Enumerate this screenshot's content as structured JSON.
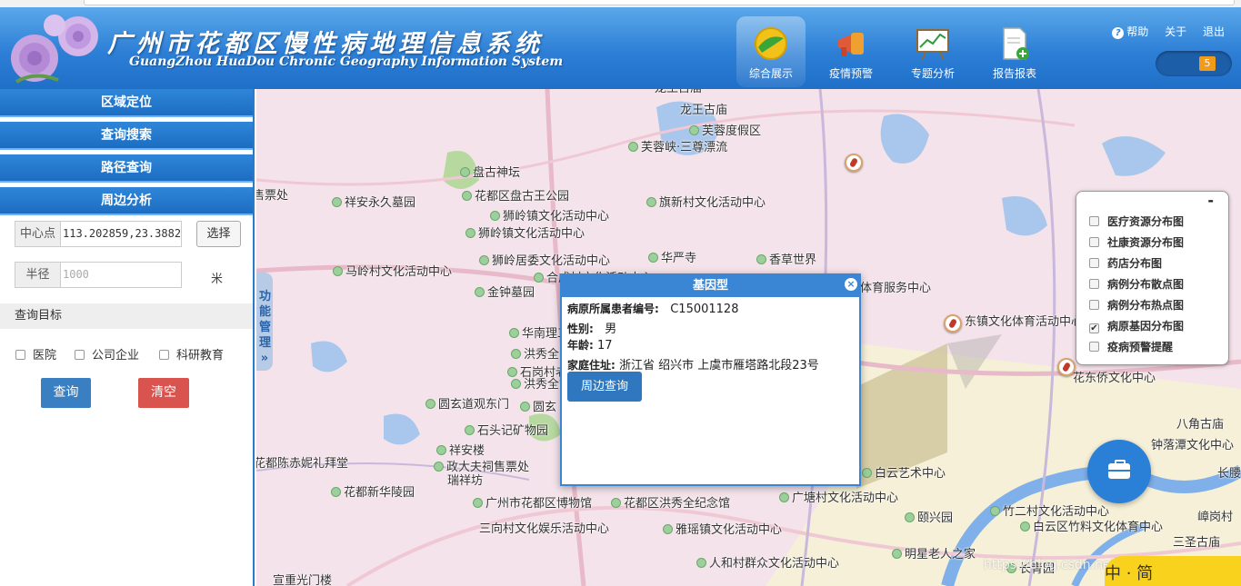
{
  "app": {
    "title_cn": "广州市花都区慢性病地理信息系统",
    "title_en": "GuangZhou HuaDou Chronic Geography Information System"
  },
  "nav": [
    {
      "label": "综合展示",
      "icon": "globe-icon"
    },
    {
      "label": "疫情预警",
      "icon": "megaphone-icon"
    },
    {
      "label": "专题分析",
      "icon": "chart-board-icon"
    },
    {
      "label": "报告报表",
      "icon": "report-add-icon"
    }
  ],
  "toplinks": {
    "help": "帮助",
    "about": "关于",
    "logout": "退出"
  },
  "notify_count": "5",
  "sidebar": {
    "sections": [
      "区域定位",
      "查询搜索",
      "路径查询",
      "周边分析"
    ],
    "center_label": "中心点",
    "center_value": "113.202859,23.38825",
    "choose": "选择",
    "radius_label": "半径",
    "radius_placeholder": "1000",
    "unit": "米",
    "target_title": "查询目标",
    "targets": [
      "医院",
      "公司企业",
      "科研教育"
    ],
    "query": "查询",
    "clear": "清空"
  },
  "side_tab": "功能管理",
  "popup": {
    "title": "基因型",
    "id_label": "病原所属患者编号:",
    "id_value": "C15001128",
    "sex_label": "性别:",
    "sex_value": "男",
    "age_label": "年龄:",
    "age_value": "17",
    "addr_label": "家庭住址:",
    "addr_value": "浙江省 绍兴市 上虞市雁塔路北段23号",
    "nearby": "周边查询"
  },
  "layers": {
    "minimize": "-",
    "items": [
      {
        "label": "医疗资源分布图",
        "checked": false
      },
      {
        "label": "社康资源分布图",
        "checked": false
      },
      {
        "label": "药店分布图",
        "checked": false
      },
      {
        "label": "病例分布散点图",
        "checked": false
      },
      {
        "label": "病例分布热点图",
        "checked": false
      },
      {
        "label": "病原基因分布图",
        "checked": true
      },
      {
        "label": "疫病预警提醒",
        "checked": false
      }
    ]
  },
  "map_places": [
    "龙王古庙",
    "芙蓉度假区",
    "芙蓉峡·三尊漂流",
    "盘古神坛",
    "花都区盘古王公园",
    "祥安永久墓园",
    "旗新村文化活动中心",
    "狮岭镇文化活动中心",
    "狮岭镇文化活动中心",
    "华严寺",
    "香草世界",
    "狮岭居委文化活动中心",
    "马岭村文化活动中心",
    "合成村文化活动中心",
    "金钟墓园",
    "华南理工",
    "洪秀全",
    "石岗村老",
    "洪秀全故",
    "圆玄道观东门",
    "圆玄",
    "石头记矿物园",
    "祥安楼",
    "政大夫祠售票处",
    "瑞祥坊",
    "花都陈赤妮礼拜堂",
    "花都新华陵园",
    "广州市花都区博物馆",
    "花都区洪秀全纪念馆",
    "三向村文化娱乐活动中心",
    "雅瑶镇文化活动中心",
    "人和村群众文化活动中心",
    "宣重光门楼",
    "体育服务中心",
    "东镇文化体育活动中心",
    "花东侨文化中心",
    "白云艺术中心",
    "广塘村文化活动中心",
    "颐兴园",
    "竹二村文化活动中心",
    "白云区竹料文化体育中心",
    "明星老人之家",
    "长青园",
    "八角古庙",
    "钟落潭文化中心",
    "长腰",
    "嶂岗村",
    "三圣古庙",
    "售票处"
  ],
  "watermark": "https://blog.csdn.net/weixin_43826111",
  "ime_text": "中 · 简"
}
